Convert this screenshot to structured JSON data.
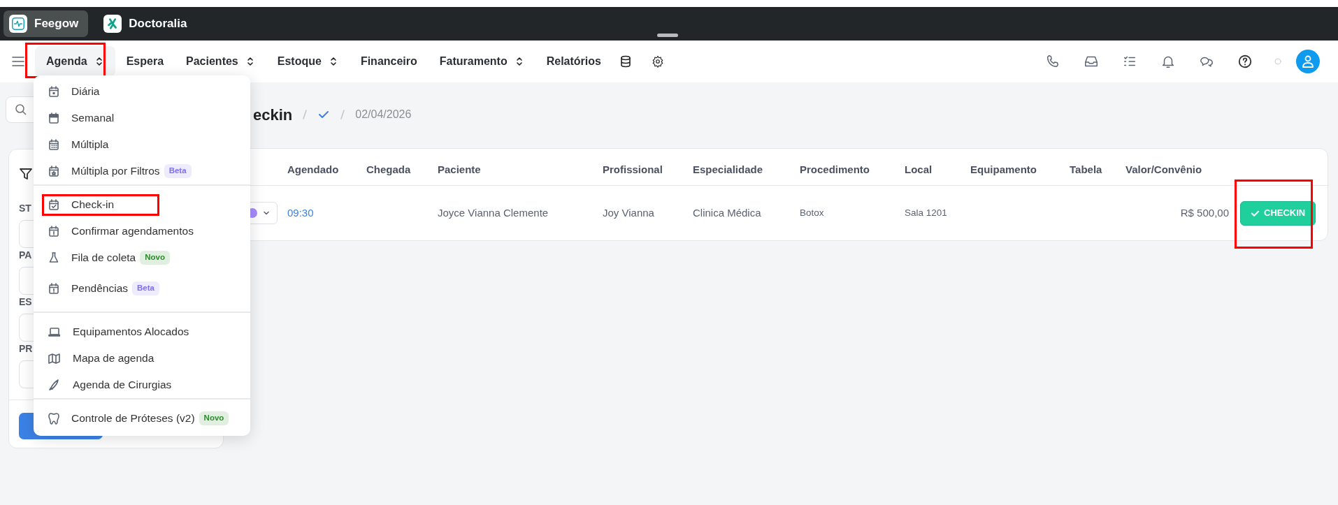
{
  "app_tabs": [
    {
      "label": "Feegow",
      "selected": true
    },
    {
      "label": "Doctoralia",
      "selected": false
    }
  ],
  "nav": {
    "items": [
      {
        "label": "Agenda",
        "submenu": true,
        "selected": true,
        "highlighted": true
      },
      {
        "label": "Espera",
        "submenu": false,
        "selected": false,
        "highlighted": false
      },
      {
        "label": "Pacientes",
        "submenu": true,
        "selected": false,
        "highlighted": false
      },
      {
        "label": "Estoque",
        "submenu": true,
        "selected": false,
        "highlighted": false
      },
      {
        "label": "Financeiro",
        "submenu": false,
        "selected": false,
        "highlighted": false
      },
      {
        "label": "Faturamento",
        "submenu": true,
        "selected": false,
        "highlighted": false
      },
      {
        "label": "Relatórios",
        "submenu": false,
        "selected": false,
        "highlighted": false
      }
    ]
  },
  "menu": {
    "sections": [
      [
        {
          "label": "Diária",
          "highlighted": false
        },
        {
          "label": "Semanal",
          "highlighted": false
        },
        {
          "label": "Múltipla",
          "highlighted": false
        },
        {
          "label": "Múltipla por Filtros",
          "highlighted": false,
          "badge": {
            "text": "Beta",
            "color": "#7b6ff0"
          }
        }
      ],
      [
        {
          "label": "Check-in",
          "highlighted": true
        },
        {
          "label": "Confirmar agendamentos",
          "highlighted": false
        },
        {
          "label": "Fila de coleta",
          "highlighted": false,
          "badge": {
            "text": "Novo",
            "color": "#2b8a2b"
          }
        },
        {
          "label": "Pendências",
          "highlighted": false,
          "badge": {
            "text": "Beta",
            "color": "#7b6ff0"
          }
        }
      ],
      [
        {
          "label": "Equipamentos Alocados",
          "highlighted": false
        },
        {
          "label": "Mapa de agenda",
          "highlighted": false
        },
        {
          "label": "Agenda de Cirurgias",
          "highlighted": false
        }
      ],
      [
        {
          "label": "Controle de Próteses (v2)",
          "highlighted": false,
          "badge": {
            "text": "Novo",
            "color": "#2b8a2b"
          }
        }
      ]
    ]
  },
  "breadcrumb": {
    "title": "eckin",
    "date": "02/04/2026"
  },
  "filters": {
    "labels": [
      "ST",
      "PA",
      "ES",
      "PR"
    ]
  },
  "table": {
    "columns": [
      "Agendado",
      "Chegada",
      "Paciente",
      "Profissional",
      "Especialidade",
      "Procedimento",
      "Local",
      "Equipamento",
      "Tabela",
      "Valor/Convênio"
    ],
    "rows": [
      {
        "cells": [
          "09:30",
          null,
          "Joyce Vianna Clemente",
          "Joy Vianna",
          "Clinica Médica",
          "Botox",
          "Sala 1201",
          null,
          null,
          "R$ 500,00"
        ],
        "action": "CHECKIN",
        "action_highlighted": true
      }
    ]
  }
}
